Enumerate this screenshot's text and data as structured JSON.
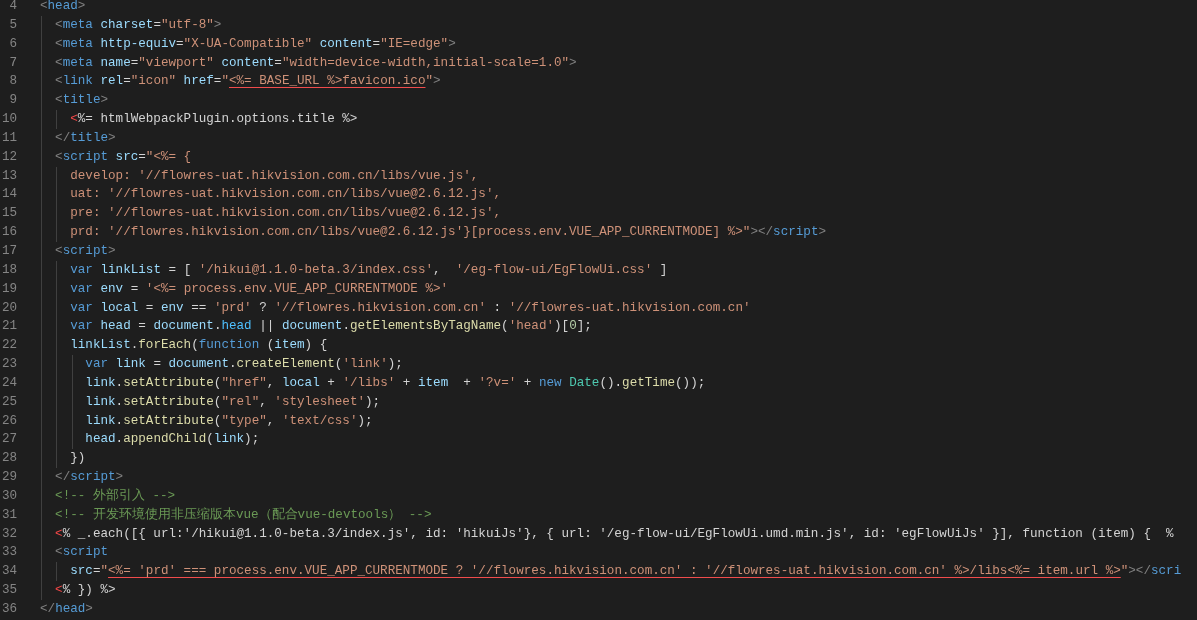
{
  "editor": {
    "lines": [
      {
        "number": "4",
        "tokens": [
          {
            "kind": "punct",
            "text": "<"
          },
          {
            "kind": "tag",
            "text": "head"
          },
          {
            "kind": "punct",
            "text": ">"
          }
        ]
      },
      {
        "number": "5",
        "tokens": [
          {
            "kind": "punct",
            "text": "  <"
          },
          {
            "kind": "tag",
            "text": "meta"
          },
          {
            "kind": "attr",
            "text": " charset"
          },
          {
            "kind": "text",
            "text": "="
          },
          {
            "kind": "string",
            "text": "\"utf-8\""
          },
          {
            "kind": "punct",
            "text": ">"
          }
        ]
      },
      {
        "number": "6",
        "tokens": [
          {
            "kind": "punct",
            "text": "  <"
          },
          {
            "kind": "tag",
            "text": "meta"
          },
          {
            "kind": "attr",
            "text": " http-equiv"
          },
          {
            "kind": "text",
            "text": "="
          },
          {
            "kind": "string",
            "text": "\"X-UA-Compatible\""
          },
          {
            "kind": "attr",
            "text": " content"
          },
          {
            "kind": "text",
            "text": "="
          },
          {
            "kind": "string",
            "text": "\"IE=edge\""
          },
          {
            "kind": "punct",
            "text": ">"
          }
        ]
      },
      {
        "number": "7",
        "tokens": [
          {
            "kind": "punct",
            "text": "  <"
          },
          {
            "kind": "tag",
            "text": "meta"
          },
          {
            "kind": "attr",
            "text": " name"
          },
          {
            "kind": "text",
            "text": "="
          },
          {
            "kind": "string",
            "text": "\"viewport\""
          },
          {
            "kind": "attr",
            "text": " content"
          },
          {
            "kind": "text",
            "text": "="
          },
          {
            "kind": "string",
            "text": "\"width=device-width,initial-scale=1.0\""
          },
          {
            "kind": "punct",
            "text": ">"
          }
        ]
      },
      {
        "number": "8",
        "tokens": [
          {
            "kind": "punct",
            "text": "  <"
          },
          {
            "kind": "tag",
            "text": "link"
          },
          {
            "kind": "attr",
            "text": " rel"
          },
          {
            "kind": "text",
            "text": "="
          },
          {
            "kind": "string",
            "text": "\"icon\""
          },
          {
            "kind": "attr",
            "text": " href"
          },
          {
            "kind": "text",
            "text": "="
          },
          {
            "kind": "string",
            "text": "\""
          },
          {
            "kind": "string-error",
            "text": "<%= BASE_URL %>favicon.ico"
          },
          {
            "kind": "string",
            "text": "\""
          },
          {
            "kind": "punct",
            "text": ">"
          }
        ]
      },
      {
        "number": "9",
        "tokens": [
          {
            "kind": "punct",
            "text": "  <"
          },
          {
            "kind": "tag",
            "text": "title"
          },
          {
            "kind": "punct",
            "text": ">"
          }
        ]
      },
      {
        "number": "10",
        "tokens": [
          {
            "kind": "error",
            "text": "    <"
          },
          {
            "kind": "text",
            "text": "%= htmlWebpackPlugin.options.title %>"
          }
        ]
      },
      {
        "number": "11",
        "tokens": [
          {
            "kind": "punct",
            "text": "  </"
          },
          {
            "kind": "tag",
            "text": "title"
          },
          {
            "kind": "punct",
            "text": ">"
          }
        ]
      },
      {
        "number": "12",
        "tokens": [
          {
            "kind": "punct",
            "text": "  <"
          },
          {
            "kind": "tag",
            "text": "script"
          },
          {
            "kind": "attr",
            "text": " src"
          },
          {
            "kind": "text",
            "text": "="
          },
          {
            "kind": "string",
            "text": "\"<%= {"
          }
        ]
      },
      {
        "number": "13",
        "tokens": [
          {
            "kind": "string",
            "text": "    develop: '//flowres-uat.hikvision.com.cn/libs/vue.js',"
          }
        ]
      },
      {
        "number": "14",
        "tokens": [
          {
            "kind": "string",
            "text": "    uat: '//flowres-uat.hikvision.com.cn/libs/vue@2.6.12.js',"
          }
        ]
      },
      {
        "number": "15",
        "tokens": [
          {
            "kind": "string",
            "text": "    pre: '//flowres-uat.hikvision.com.cn/libs/vue@2.6.12.js',"
          }
        ]
      },
      {
        "number": "16",
        "tokens": [
          {
            "kind": "string",
            "text": "    prd: '//flowres.hikvision.com.cn/libs/vue@2.6.12.js'}[process.env.VUE_APP_CURRENTMODE] %>\""
          },
          {
            "kind": "punct",
            "text": "></"
          },
          {
            "kind": "tag",
            "text": "script"
          },
          {
            "kind": "punct",
            "text": ">"
          }
        ]
      },
      {
        "number": "17",
        "tokens": [
          {
            "kind": "punct",
            "text": "  <"
          },
          {
            "kind": "tag",
            "text": "script"
          },
          {
            "kind": "punct",
            "text": ">"
          }
        ]
      },
      {
        "number": "18",
        "tokens": [
          {
            "kind": "keyword",
            "text": "    var"
          },
          {
            "kind": "variable",
            "text": " linkList"
          },
          {
            "kind": "text",
            "text": " = [ "
          },
          {
            "kind": "string",
            "text": "'/hikui@1.1.0-beta.3/index.css'"
          },
          {
            "kind": "text",
            "text": ",  "
          },
          {
            "kind": "string",
            "text": "'/eg-flow-ui/EgFlowUi.css'"
          },
          {
            "kind": "text",
            "text": " ]"
          }
        ]
      },
      {
        "number": "19",
        "tokens": [
          {
            "kind": "keyword",
            "text": "    var"
          },
          {
            "kind": "variable",
            "text": " env"
          },
          {
            "kind": "text",
            "text": " = "
          },
          {
            "kind": "string",
            "text": "'<%= process.env.VUE_APP_CURRENTMODE %>'"
          }
        ]
      },
      {
        "number": "20",
        "tokens": [
          {
            "kind": "keyword",
            "text": "    var"
          },
          {
            "kind": "variable",
            "text": " local"
          },
          {
            "kind": "text",
            "text": " = "
          },
          {
            "kind": "variable",
            "text": "env"
          },
          {
            "kind": "text",
            "text": " == "
          },
          {
            "kind": "string",
            "text": "'prd'"
          },
          {
            "kind": "text",
            "text": " ? "
          },
          {
            "kind": "string",
            "text": "'//flowres.hikvision.com.cn'"
          },
          {
            "kind": "text",
            "text": " : "
          },
          {
            "kind": "string",
            "text": "'//flowres-uat.hikvision.com.cn'"
          }
        ]
      },
      {
        "number": "21",
        "tokens": [
          {
            "kind": "keyword",
            "text": "    var"
          },
          {
            "kind": "variable",
            "text": " head"
          },
          {
            "kind": "text",
            "text": " = "
          },
          {
            "kind": "variable",
            "text": "document"
          },
          {
            "kind": "text",
            "text": "."
          },
          {
            "kind": "property",
            "text": "head"
          },
          {
            "kind": "text",
            "text": " || "
          },
          {
            "kind": "variable",
            "text": "document"
          },
          {
            "kind": "text",
            "text": "."
          },
          {
            "kind": "function",
            "text": "getElementsByTagName"
          },
          {
            "kind": "text",
            "text": "("
          },
          {
            "kind": "string",
            "text": "'head'"
          },
          {
            "kind": "text",
            "text": ")["
          },
          {
            "kind": "number",
            "text": "0"
          },
          {
            "kind": "text",
            "text": "];"
          }
        ]
      },
      {
        "number": "22",
        "tokens": [
          {
            "kind": "variable",
            "text": "    linkList"
          },
          {
            "kind": "text",
            "text": "."
          },
          {
            "kind": "function",
            "text": "forEach"
          },
          {
            "kind": "text",
            "text": "("
          },
          {
            "kind": "keyword",
            "text": "function"
          },
          {
            "kind": "text",
            "text": " ("
          },
          {
            "kind": "variable",
            "text": "item"
          },
          {
            "kind": "text",
            "text": ") {"
          }
        ]
      },
      {
        "number": "23",
        "tokens": [
          {
            "kind": "keyword",
            "text": "      var"
          },
          {
            "kind": "variable",
            "text": " link"
          },
          {
            "kind": "text",
            "text": " = "
          },
          {
            "kind": "variable",
            "text": "document"
          },
          {
            "kind": "text",
            "text": "."
          },
          {
            "kind": "function",
            "text": "createElement"
          },
          {
            "kind": "text",
            "text": "("
          },
          {
            "kind": "string",
            "text": "'link'"
          },
          {
            "kind": "text",
            "text": ");"
          }
        ]
      },
      {
        "number": "24",
        "tokens": [
          {
            "kind": "variable",
            "text": "      link"
          },
          {
            "kind": "text",
            "text": "."
          },
          {
            "kind": "function",
            "text": "setAttribute"
          },
          {
            "kind": "text",
            "text": "("
          },
          {
            "kind": "string",
            "text": "\"href\""
          },
          {
            "kind": "text",
            "text": ", "
          },
          {
            "kind": "variable",
            "text": "local"
          },
          {
            "kind": "text",
            "text": " + "
          },
          {
            "kind": "string",
            "text": "'/libs'"
          },
          {
            "kind": "text",
            "text": " + "
          },
          {
            "kind": "variable",
            "text": "item"
          },
          {
            "kind": "text",
            "text": "  + "
          },
          {
            "kind": "string",
            "text": "'?v='"
          },
          {
            "kind": "text",
            "text": " + "
          },
          {
            "kind": "keyword",
            "text": "new"
          },
          {
            "kind": "class",
            "text": " Date"
          },
          {
            "kind": "text",
            "text": "()."
          },
          {
            "kind": "function",
            "text": "getTime"
          },
          {
            "kind": "text",
            "text": "());"
          }
        ]
      },
      {
        "number": "25",
        "tokens": [
          {
            "kind": "variable",
            "text": "      link"
          },
          {
            "kind": "text",
            "text": "."
          },
          {
            "kind": "function",
            "text": "setAttribute"
          },
          {
            "kind": "text",
            "text": "("
          },
          {
            "kind": "string",
            "text": "\"rel\""
          },
          {
            "kind": "text",
            "text": ", "
          },
          {
            "kind": "string",
            "text": "'stylesheet'"
          },
          {
            "kind": "text",
            "text": ");"
          }
        ]
      },
      {
        "number": "26",
        "tokens": [
          {
            "kind": "variable",
            "text": "      link"
          },
          {
            "kind": "text",
            "text": "."
          },
          {
            "kind": "function",
            "text": "setAttribute"
          },
          {
            "kind": "text",
            "text": "("
          },
          {
            "kind": "string",
            "text": "\"type\""
          },
          {
            "kind": "text",
            "text": ", "
          },
          {
            "kind": "string",
            "text": "'text/css'"
          },
          {
            "kind": "text",
            "text": ");"
          }
        ]
      },
      {
        "number": "27",
        "tokens": [
          {
            "kind": "variable",
            "text": "      head"
          },
          {
            "kind": "text",
            "text": "."
          },
          {
            "kind": "function",
            "text": "appendChild"
          },
          {
            "kind": "text",
            "text": "("
          },
          {
            "kind": "variable",
            "text": "link"
          },
          {
            "kind": "text",
            "text": ");"
          }
        ]
      },
      {
        "number": "28",
        "tokens": [
          {
            "kind": "text",
            "text": "    })"
          }
        ]
      },
      {
        "number": "29",
        "tokens": [
          {
            "kind": "punct",
            "text": "  </"
          },
          {
            "kind": "tag",
            "text": "script"
          },
          {
            "kind": "punct",
            "text": ">"
          }
        ]
      },
      {
        "number": "30",
        "tokens": [
          {
            "kind": "comment",
            "text": "  <!-- 外部引入 -->"
          }
        ]
      },
      {
        "number": "31",
        "tokens": [
          {
            "kind": "comment",
            "text": "  <!-- 开发环境使用非压缩版本vue（配合vue-devtools） -->"
          }
        ]
      },
      {
        "number": "32",
        "tokens": [
          {
            "kind": "error",
            "text": "  <"
          },
          {
            "kind": "text",
            "text": "% _.each([{ url:'/hikui@1.1.0-beta.3/index.js', id: 'hikuiJs'}, { url: '/eg-flow-ui/EgFlowUi.umd.min.js', id: 'egFlowUiJs' }], function (item) {  %"
          }
        ]
      },
      {
        "number": "33",
        "tokens": [
          {
            "kind": "punct",
            "text": "  <"
          },
          {
            "kind": "tag",
            "text": "script"
          }
        ]
      },
      {
        "number": "34",
        "tokens": [
          {
            "kind": "attr",
            "text": "    src"
          },
          {
            "kind": "text",
            "text": "="
          },
          {
            "kind": "string",
            "text": "\""
          },
          {
            "kind": "string-error",
            "text": "<%= 'prd' === process.env.VUE_APP_CURRENTMODE ? '//flowres.hikvision.com.cn' : '//flowres-uat.hikvision.com.cn' %>/libs<%= item.url %>"
          },
          {
            "kind": "string",
            "text": "\""
          },
          {
            "kind": "punct",
            "text": "></"
          },
          {
            "kind": "tag",
            "text": "scri"
          }
        ]
      },
      {
        "number": "35",
        "tokens": [
          {
            "kind": "error",
            "text": "  <"
          },
          {
            "kind": "text",
            "text": "% }) %>"
          }
        ]
      },
      {
        "number": "36",
        "tokens": [
          {
            "kind": "punct",
            "text": "</"
          },
          {
            "kind": "tag",
            "text": "head"
          },
          {
            "kind": "punct",
            "text": ">"
          }
        ]
      }
    ]
  }
}
